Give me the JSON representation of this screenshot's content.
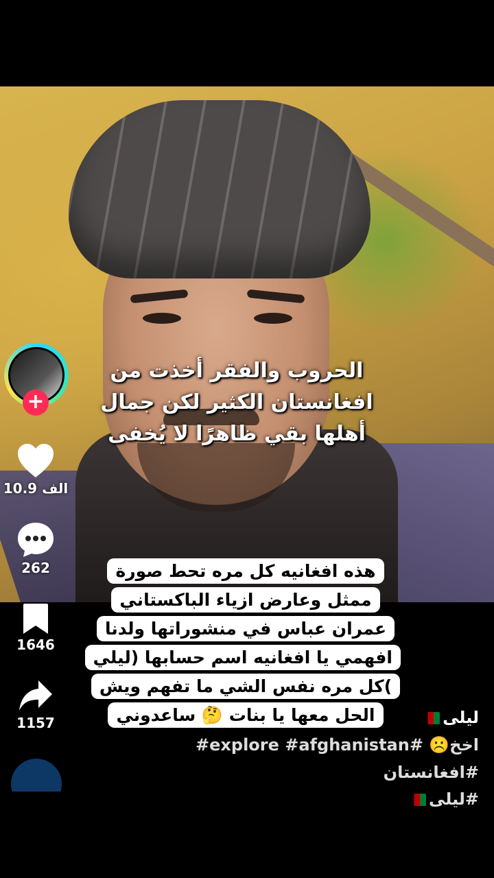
{
  "video": {
    "overlay_caption": "الحروب والفقر أخذت من افغانستان الكثير لكن جمال أهلها بقي ظاهرًا لا يُخفى",
    "sticker_text": "هذه افغانيه كل مره تحط صورة ممثل وعارض ازياء الباكستاني عمران عباس في منشوراتها ولدنا افهمي يا افغانيه اسم حسابها (ليلي )كل مره نفس الشي ما تفهم ويش الحل معها يا بنات 🤔 ساعدوني"
  },
  "actions": {
    "likes": "10.9 الف",
    "comments": "262",
    "saves": "1646",
    "shares": "1157"
  },
  "description": {
    "username": "ليلى",
    "line1": "اخخ☹️ #explore #afghanistan# #افغانستان",
    "line2": "#ليلى"
  },
  "colors": {
    "follow_accent": "#fe2c55",
    "flag": [
      "#000000",
      "#be0000",
      "#007a36"
    ]
  },
  "icons": [
    "plus-icon",
    "heart-icon",
    "comment-icon",
    "bookmark-icon",
    "share-icon",
    "afghanistan-flag-icon"
  ]
}
